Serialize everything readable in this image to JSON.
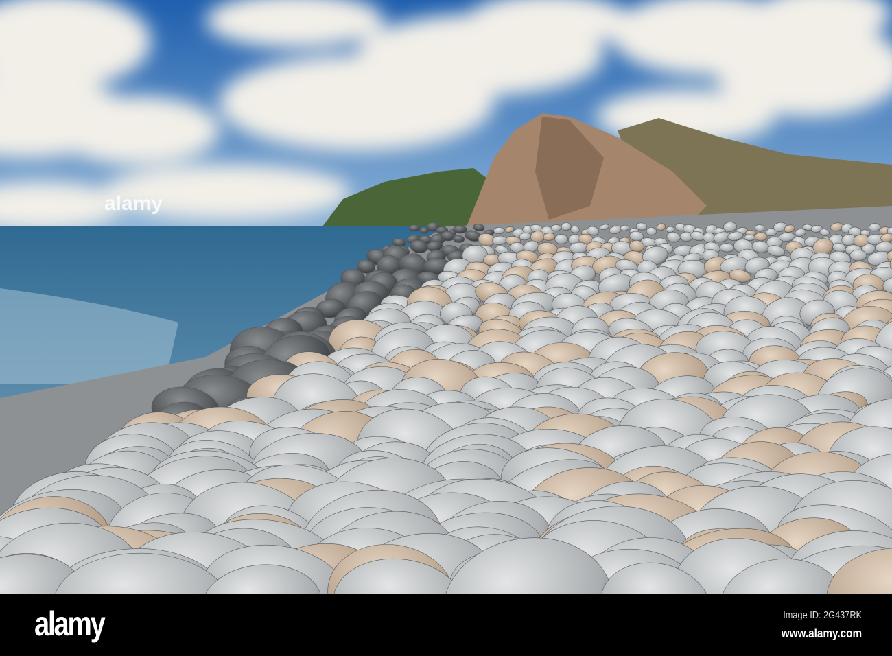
{
  "photo": {
    "watermark": "alamy",
    "colors": {
      "sky": "#2d6fb8",
      "cloud": "#f1efe9",
      "sea": "#3d7396",
      "boulder": "#b9bcbd",
      "cliff": "#9b8068",
      "hill": "#4f6b3c"
    }
  },
  "footer": {
    "logo": "alamy",
    "image_id": "Image ID: 2G437RK",
    "url": "www.alamy.com"
  }
}
